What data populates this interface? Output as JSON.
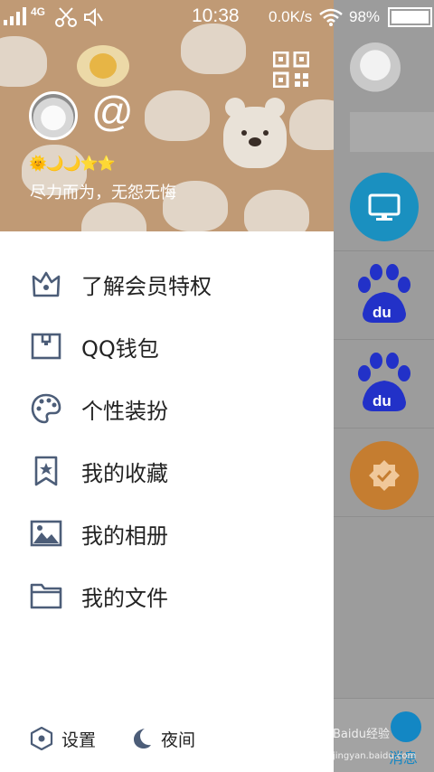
{
  "status_bar": {
    "network": "4G",
    "time": "10:38",
    "speed": "0.0K/s",
    "battery": "98%"
  },
  "profile": {
    "name": "@",
    "levels": "🌞🌙🌙⭐⭐",
    "signature": "尽力而为，无怨无悔"
  },
  "menu": [
    {
      "label": "了解会员特权",
      "icon": "crown-icon"
    },
    {
      "label": "QQ钱包",
      "icon": "wallet-icon"
    },
    {
      "label": "个性装扮",
      "icon": "palette-icon"
    },
    {
      "label": "我的收藏",
      "icon": "bookmark-star-icon"
    },
    {
      "label": "我的相册",
      "icon": "photo-icon"
    },
    {
      "label": "我的文件",
      "icon": "folder-icon"
    }
  ],
  "footer": {
    "settings_label": "设置",
    "night_label": "夜间"
  },
  "background": {
    "tab_label": "消息",
    "watermark": "Baidu经验",
    "watermark_url": "jingyan.baidu.com"
  },
  "colors": {
    "header_bg": "#c09a75",
    "icon_color": "#4c5d78",
    "accent_blue": "#1387c4",
    "baidu_blue": "#2231c8"
  }
}
